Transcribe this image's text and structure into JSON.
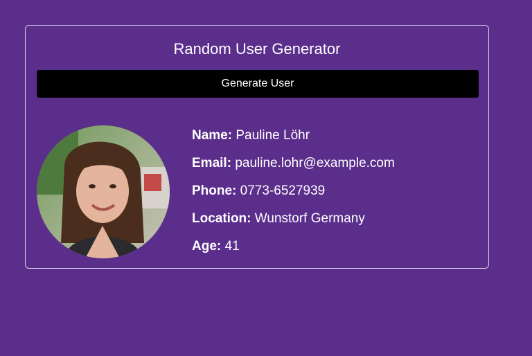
{
  "app": {
    "title": "Random User Generator",
    "generate_label": "Generate User"
  },
  "user": {
    "name_label": "Name:",
    "name": "Pauline Löhr",
    "email_label": "Email:",
    "email": "pauline.lohr@example.com",
    "phone_label": "Phone:",
    "phone": "0773-6527939",
    "location_label": "Location:",
    "location": "Wunstorf Germany",
    "age_label": "Age:",
    "age": "41"
  },
  "colors": {
    "background": "#5b2e8c",
    "button": "#000000",
    "text": "#ffffff"
  }
}
